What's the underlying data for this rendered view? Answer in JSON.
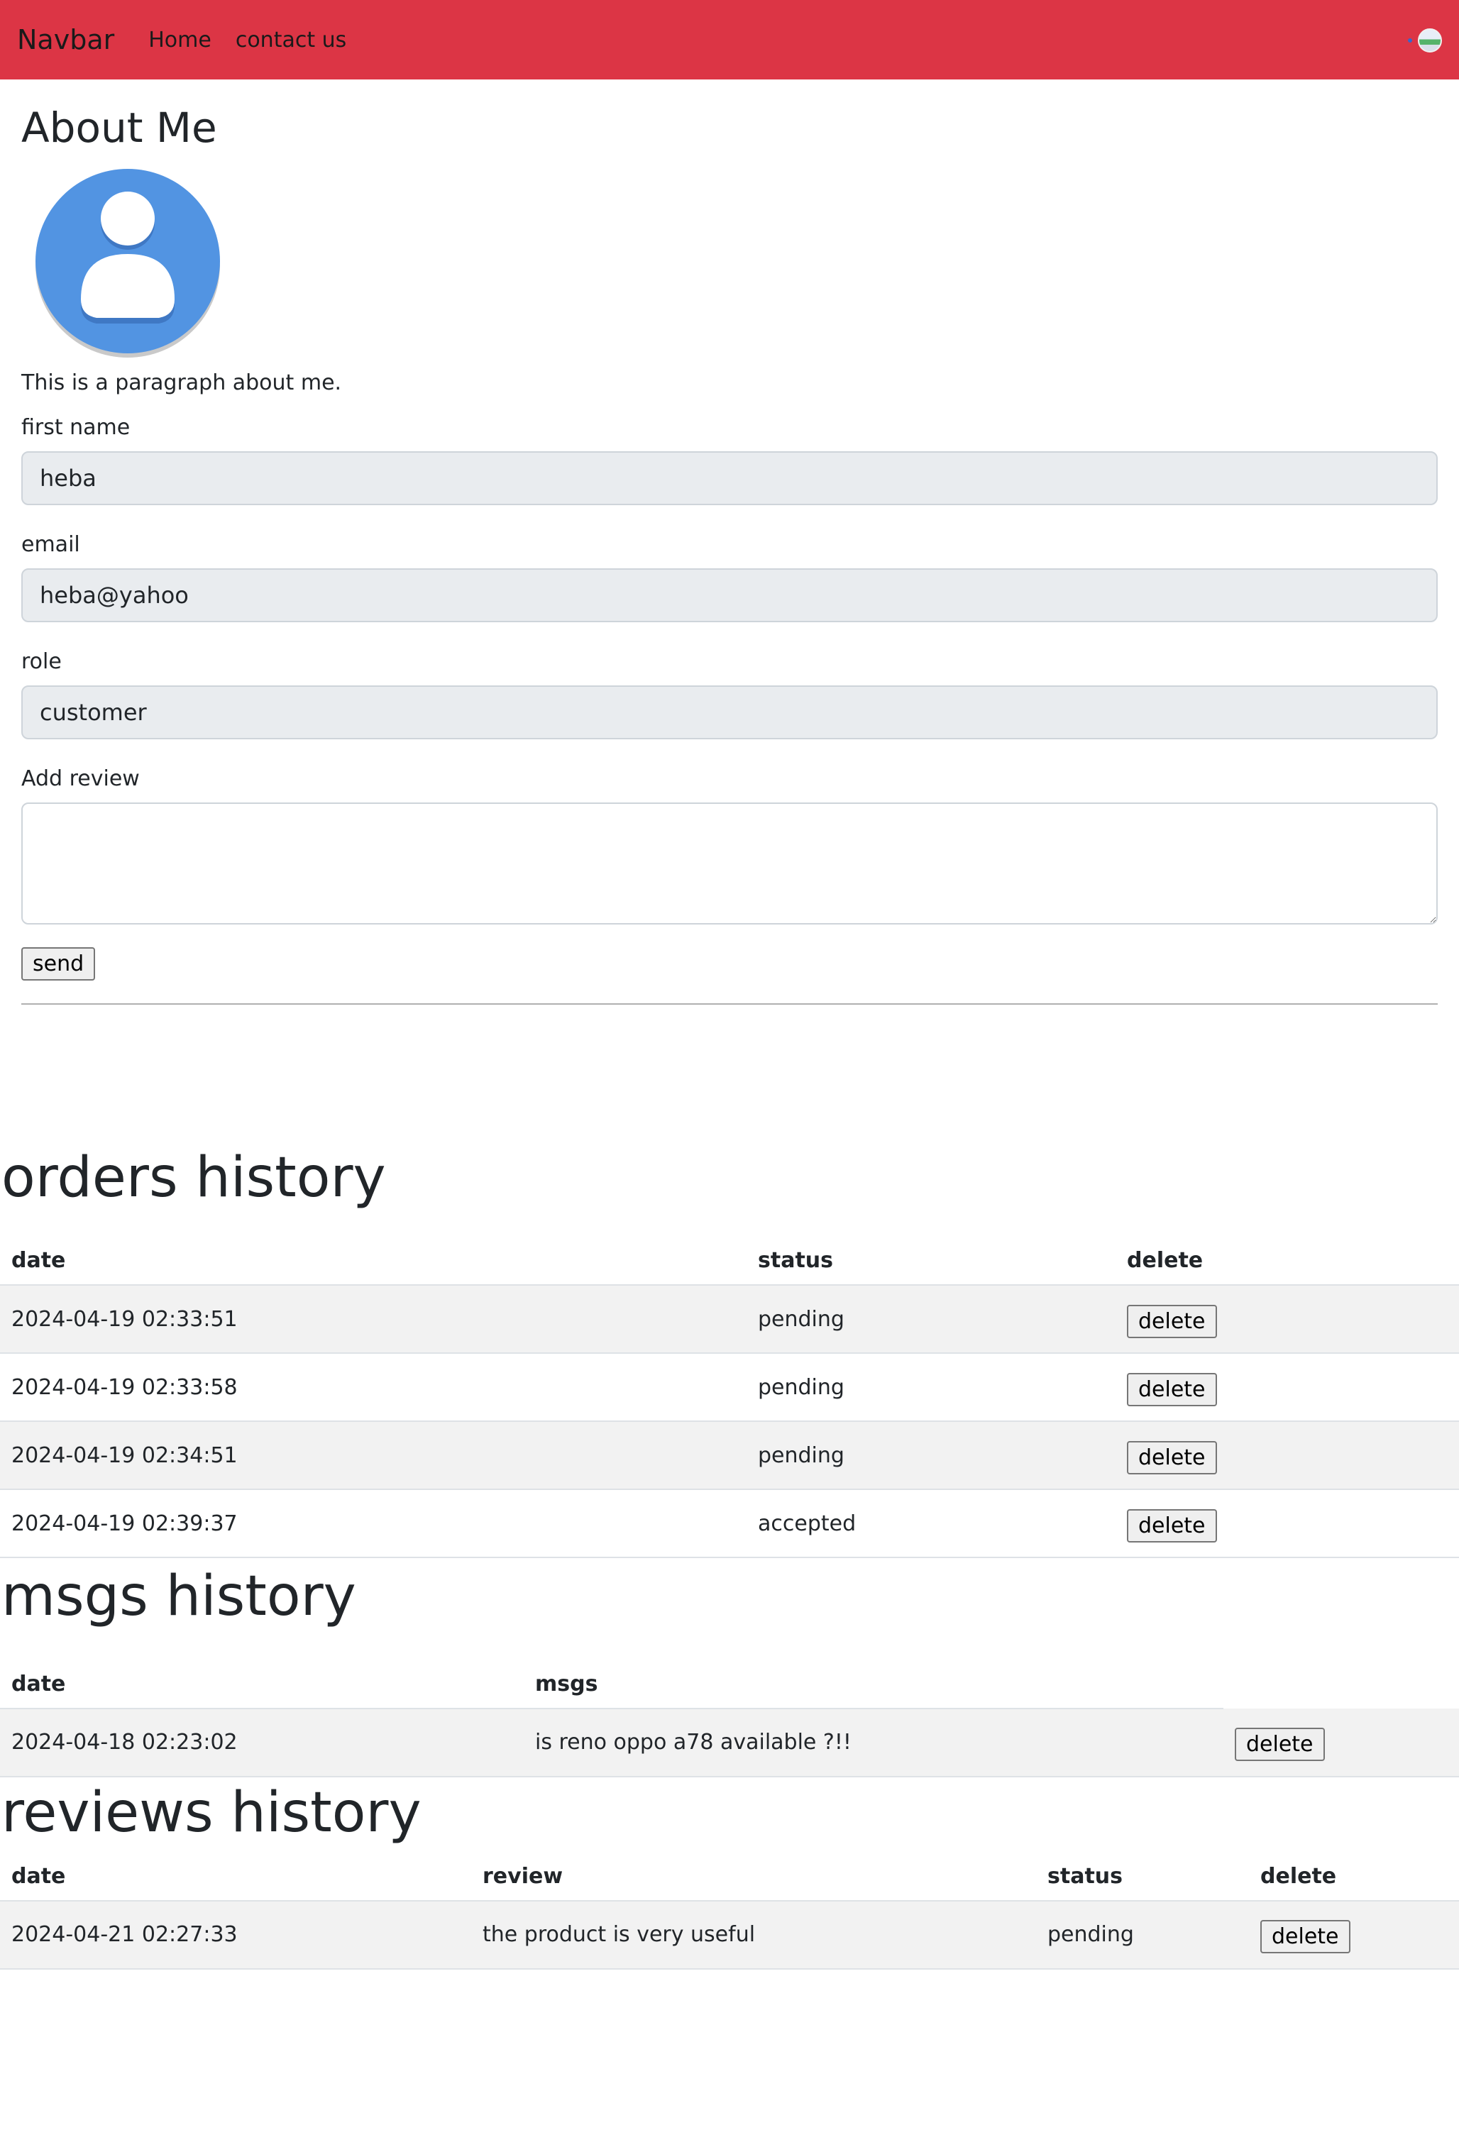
{
  "navbar": {
    "brand": "Navbar",
    "links": [
      "Home",
      "contact us"
    ]
  },
  "about": {
    "title": "About Me",
    "paragraph": "This is a paragraph about me.",
    "fields": {
      "first_name": {
        "label": "first name",
        "value": "heba"
      },
      "email": {
        "label": "email",
        "value": "heba@yahoo"
      },
      "role": {
        "label": "role",
        "value": "customer"
      }
    },
    "review_label": "Add review",
    "review_placeholder": "",
    "send_label": "send"
  },
  "orders": {
    "title": "orders history",
    "headers": [
      "date",
      "status",
      "delete"
    ],
    "rows": [
      {
        "date": "2024-04-19 02:33:51",
        "status": "pending",
        "action": "delete"
      },
      {
        "date": "2024-04-19 02:33:58",
        "status": "pending",
        "action": "delete"
      },
      {
        "date": "2024-04-19 02:34:51",
        "status": "pending",
        "action": "delete"
      },
      {
        "date": "2024-04-19 02:39:37",
        "status": "accepted",
        "action": "delete"
      }
    ]
  },
  "msgs": {
    "title": "msgs history",
    "headers": [
      "date",
      "msgs"
    ],
    "rows": [
      {
        "date": "2024-04-18 02:23:02",
        "msg": "is reno oppo a78 available ?!!",
        "action": "delete"
      }
    ]
  },
  "reviews": {
    "title": "reviews history",
    "headers": [
      "date",
      "review",
      "status",
      "delete"
    ],
    "rows": [
      {
        "date": "2024-04-21 02:27:33",
        "review": "the product is very useful",
        "status": "pending",
        "action": "delete"
      }
    ]
  },
  "colors": {
    "navbar_bg": "#dc3545",
    "avatar_blue": "#5294e2",
    "input_bg": "#e9ecef",
    "row_stripe": "#f2f2f2"
  }
}
